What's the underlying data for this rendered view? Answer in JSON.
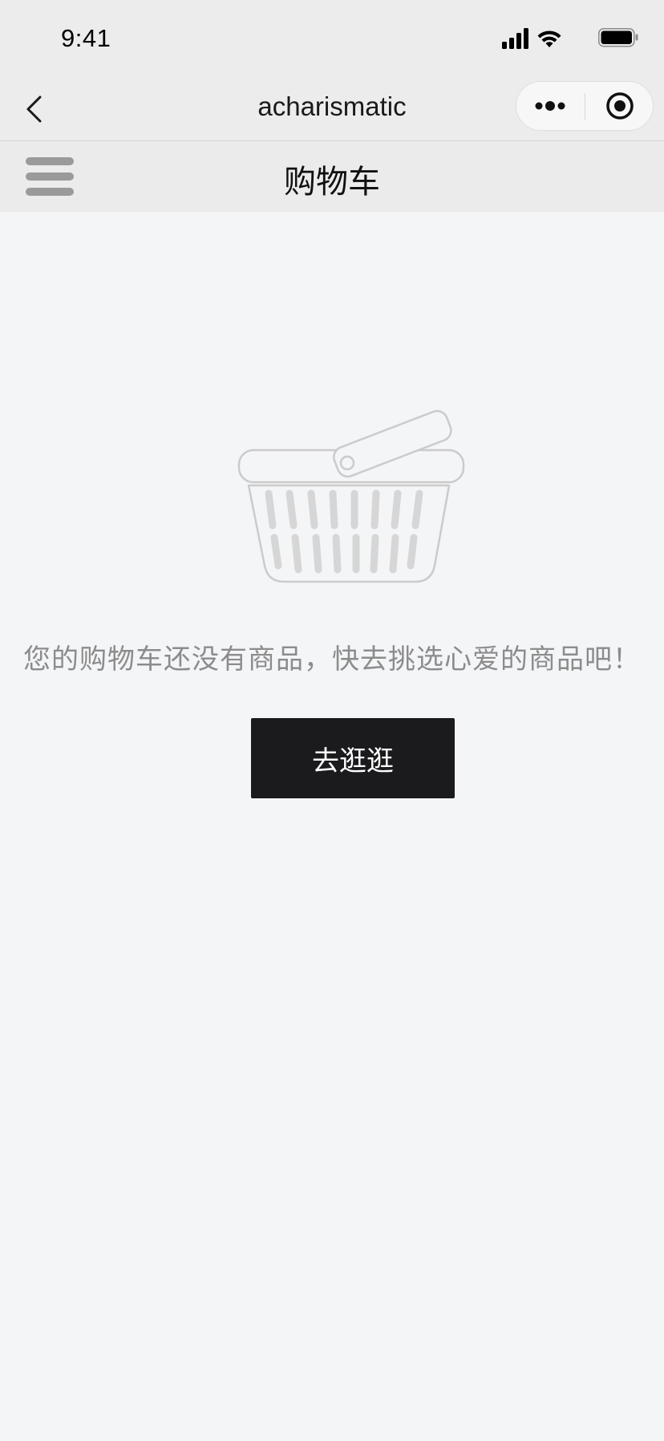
{
  "status_bar": {
    "time": "9:41"
  },
  "nav_bar": {
    "title": "acharismatic",
    "back_icon": "chevron-left-icon",
    "capsule_more_icon": "more-dots-icon",
    "capsule_close_icon": "target-close-icon"
  },
  "page_header": {
    "menu_icon": "hamburger-icon",
    "title": "购物车"
  },
  "empty_state": {
    "illustration": "basket-icon",
    "message": "您的购物车还没有商品，快去挑选心爱的商品吧！",
    "button_label": "去逛逛"
  },
  "colors": {
    "background": "#f4f5f7",
    "header_bg": "#ebebeb",
    "button_bg": "#1b1b1d",
    "message_text": "#8c8c8c"
  }
}
